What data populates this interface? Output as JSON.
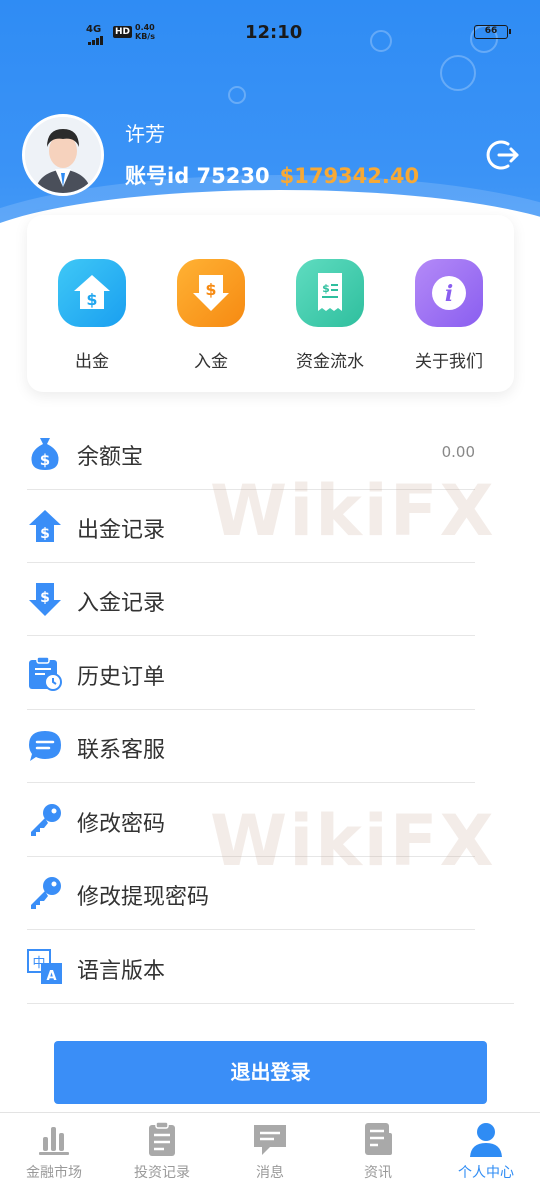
{
  "status_bar": {
    "network": "4G",
    "hd": "HD",
    "speed_value": "0.40",
    "speed_unit": "KB/s",
    "time": "12:10",
    "battery": "66"
  },
  "profile": {
    "name": "许芳",
    "account_label": "账号id 75230",
    "balance": "$179342.40"
  },
  "quick_actions": [
    {
      "label": "出金",
      "icon": "house-dollar-icon",
      "color": "#1fb4ef"
    },
    {
      "label": "入金",
      "icon": "arrow-down-dollar-icon",
      "color": "#f79a1e"
    },
    {
      "label": "资金流水",
      "icon": "receipt-icon",
      "color": "#3fd0b0"
    },
    {
      "label": "关于我们",
      "icon": "info-icon",
      "color": "#9b6ef0"
    }
  ],
  "menu": [
    {
      "label": "余额宝",
      "value": "0.00",
      "icon": "money-bag-icon"
    },
    {
      "label": "出金记录",
      "icon": "house-dollar-icon"
    },
    {
      "label": "入金记录",
      "icon": "arrow-down-dollar-icon"
    },
    {
      "label": "历史订单",
      "icon": "clipboard-clock-icon"
    },
    {
      "label": "联系客服",
      "icon": "chat-bubble-icon"
    },
    {
      "label": "修改密码",
      "icon": "key-icon"
    },
    {
      "label": "修改提现密码",
      "icon": "key-icon"
    },
    {
      "label": "语言版本",
      "icon": "translate-icon"
    }
  ],
  "logout_button": "退出登录",
  "tabs": [
    {
      "label": "金融市场",
      "icon": "bar-chart-icon"
    },
    {
      "label": "投资记录",
      "icon": "clipboard-icon"
    },
    {
      "label": "消息",
      "icon": "message-icon"
    },
    {
      "label": "资讯",
      "icon": "news-icon"
    },
    {
      "label": "个人中心",
      "icon": "person-icon",
      "active": true
    }
  ],
  "colors": {
    "primary": "#2f8cf4",
    "balance": "#f7a935",
    "icon_blue": "#3a8ef7"
  },
  "watermark": "WikiFX"
}
